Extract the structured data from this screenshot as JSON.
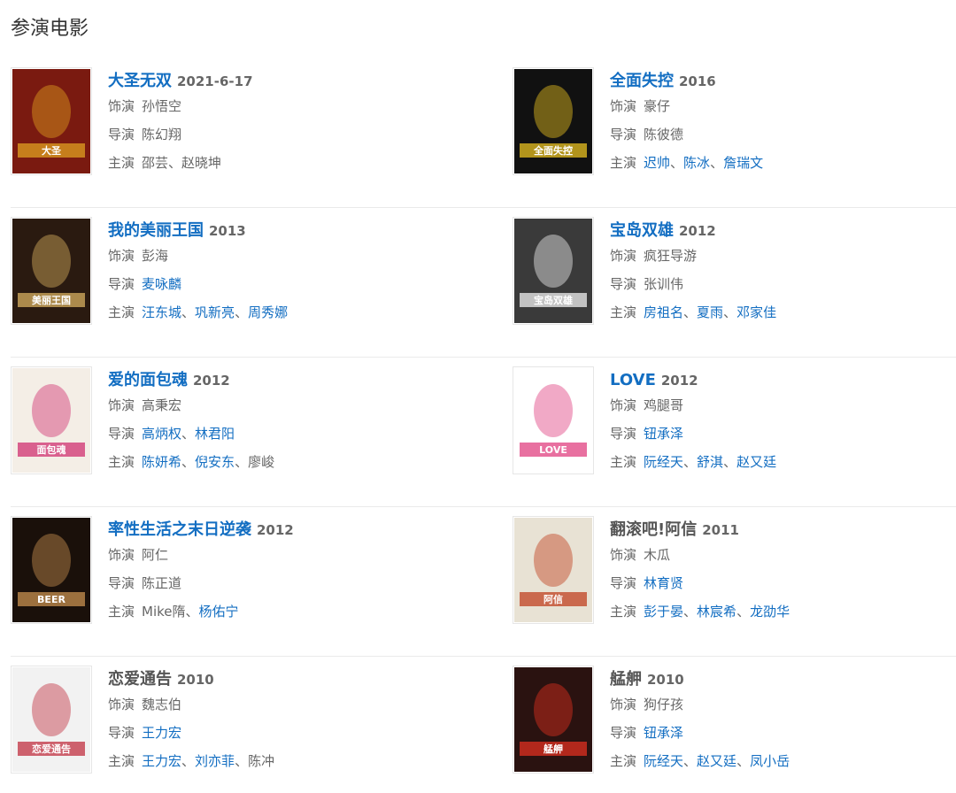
{
  "section_title": "参演电影",
  "labels": {
    "role": "饰演",
    "director": "导演",
    "stars": "主演"
  },
  "movies": [
    {
      "title": "大圣无双",
      "title_link": true,
      "year": "2021-6-17",
      "role": "孙悟空",
      "director": [
        {
          "name": "陈幻翔",
          "link": false
        }
      ],
      "stars": [
        {
          "name": "邵芸",
          "link": false
        },
        {
          "name": "赵晓坤",
          "link": false
        }
      ],
      "poster": {
        "bg": "#7a1a10",
        "accent": "#e0a020",
        "text": "大圣"
      }
    },
    {
      "title": "全面失控",
      "title_link": true,
      "year": "2016",
      "role": "豪仔",
      "director": [
        {
          "name": "陈彼德",
          "link": false
        }
      ],
      "stars": [
        {
          "name": "迟帅",
          "link": true
        },
        {
          "name": "陈冰",
          "link": true
        },
        {
          "name": "詹瑞文",
          "link": true
        }
      ],
      "poster": {
        "bg": "#111111",
        "accent": "#e8c020",
        "text": "全面失控"
      }
    },
    {
      "title": "我的美丽王国",
      "title_link": true,
      "year": "2013",
      "role": "彭海",
      "director": [
        {
          "name": "麦咏麟",
          "link": true
        }
      ],
      "stars": [
        {
          "name": "汪东城",
          "link": true
        },
        {
          "name": "巩新亮",
          "link": true
        },
        {
          "name": "周秀娜",
          "link": true
        }
      ],
      "poster": {
        "bg": "#2a1a10",
        "accent": "#d8b060",
        "text": "美丽王国"
      }
    },
    {
      "title": "宝岛双雄",
      "title_link": true,
      "year": "2012",
      "role": "疯狂导游",
      "director": [
        {
          "name": "张训伟",
          "link": false
        }
      ],
      "stars": [
        {
          "name": "房祖名",
          "link": true
        },
        {
          "name": "夏雨",
          "link": true
        },
        {
          "name": "邓家佳",
          "link": true
        }
      ],
      "poster": {
        "bg": "#3a3a3a",
        "accent": "#f0f0f0",
        "text": "宝岛双雄"
      }
    },
    {
      "title": "爱的面包魂",
      "title_link": true,
      "year": "2012",
      "role": "高秉宏",
      "director": [
        {
          "name": "高炳权",
          "link": true
        },
        {
          "name": "林君阳",
          "link": true
        }
      ],
      "stars": [
        {
          "name": "陈妍希",
          "link": true
        },
        {
          "name": "倪安东",
          "link": true
        },
        {
          "name": "廖峻",
          "link": false
        }
      ],
      "poster": {
        "bg": "#f4eee6",
        "accent": "#d03070",
        "text": "面包魂"
      }
    },
    {
      "title": "LOVE",
      "title_link": true,
      "year": "2012",
      "role": "鸡腿哥",
      "director": [
        {
          "name": "钮承泽",
          "link": true
        }
      ],
      "stars": [
        {
          "name": "阮经天",
          "link": true
        },
        {
          "name": "舒淇",
          "link": true
        },
        {
          "name": "赵又廷",
          "link": true
        }
      ],
      "poster": {
        "bg": "#ffffff",
        "accent": "#e04080",
        "text": "LOVE"
      }
    },
    {
      "title": "率性生活之末日逆袭",
      "title_link": true,
      "year": "2012",
      "role": "阿仁",
      "director": [
        {
          "name": "陈正道",
          "link": false
        }
      ],
      "stars": [
        {
          "name": "Mike隋",
          "link": false
        },
        {
          "name": "杨佑宁",
          "link": true
        }
      ],
      "poster": {
        "bg": "#1a100a",
        "accent": "#c89050",
        "text": "BEER"
      }
    },
    {
      "title": "翻滚吧!阿信",
      "title_link": false,
      "year": "2011",
      "role": "木瓜",
      "director": [
        {
          "name": "林育贤",
          "link": true
        }
      ],
      "stars": [
        {
          "name": "彭于晏",
          "link": true
        },
        {
          "name": "林宸希",
          "link": true
        },
        {
          "name": "龙劭华",
          "link": true
        }
      ],
      "poster": {
        "bg": "#e8e2d4",
        "accent": "#c04020",
        "text": "阿信"
      }
    },
    {
      "title": "恋爱通告",
      "title_link": false,
      "year": "2010",
      "role": "魏志伯",
      "director": [
        {
          "name": "王力宏",
          "link": true
        }
      ],
      "stars": [
        {
          "name": "王力宏",
          "link": true
        },
        {
          "name": "刘亦菲",
          "link": true
        },
        {
          "name": "陈冲",
          "link": false
        }
      ],
      "poster": {
        "bg": "#f2f2f2",
        "accent": "#c03040",
        "text": "恋爱通告"
      }
    },
    {
      "title": "艋舺",
      "title_link": false,
      "year": "2010",
      "role": "狗仔孩",
      "director": [
        {
          "name": "钮承泽",
          "link": true
        }
      ],
      "stars": [
        {
          "name": "阮经天",
          "link": true
        },
        {
          "name": "赵又廷",
          "link": true
        },
        {
          "name": "凤小岳",
          "link": true
        }
      ],
      "poster": {
        "bg": "#2a1210",
        "accent": "#e03020",
        "text": "艋舺"
      }
    }
  ]
}
